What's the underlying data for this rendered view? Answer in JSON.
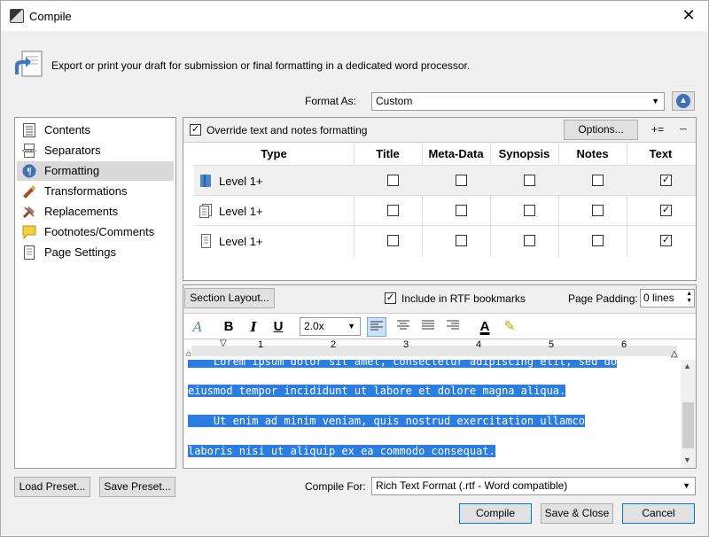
{
  "window": {
    "title": "Compile",
    "close_glyph": "✕"
  },
  "header": {
    "description": "Export or print your draft for submission or final formatting in a dedicated word processor.",
    "icon": "export-icon"
  },
  "format_as": {
    "label": "Format As:",
    "value": "Custom"
  },
  "sidebar": {
    "items": [
      {
        "label": "Contents",
        "icon": "contents-icon"
      },
      {
        "label": "Separators",
        "icon": "separators-icon"
      },
      {
        "label": "Formatting",
        "icon": "formatting-icon",
        "selected": true
      },
      {
        "label": "Transformations",
        "icon": "transformations-icon"
      },
      {
        "label": "Replacements",
        "icon": "replacements-icon"
      },
      {
        "label": "Footnotes/Comments",
        "icon": "footnotes-icon"
      },
      {
        "label": "Page Settings",
        "icon": "page-settings-icon"
      }
    ]
  },
  "formatting": {
    "override_label": "Override text and notes formatting",
    "override_checked": true,
    "options_label": "Options...",
    "add_label": "+=",
    "remove_label": "−",
    "columns": [
      "Type",
      "Title",
      "Meta-Data",
      "Synopsis",
      "Notes",
      "Text"
    ],
    "rows": [
      {
        "label": "Level 1+",
        "icon": "folder-icon",
        "checks": [
          "",
          "",
          "",
          "",
          "✓"
        ]
      },
      {
        "label": "Level 1+",
        "icon": "document-group-icon",
        "checks": [
          "",
          "",
          "",
          "",
          "✓"
        ]
      },
      {
        "label": "Level 1+",
        "icon": "document-icon",
        "checks": [
          "",
          "",
          "",
          "",
          "✓"
        ]
      }
    ]
  },
  "section": {
    "layout_button": "Section Layout...",
    "rtf_label": "Include in RTF bookmarks",
    "rtf_checked": "✓",
    "padding_label": "Page Padding:",
    "padding_value": "0 lines"
  },
  "toolbar": {
    "styles_glyph": "A",
    "bold": "B",
    "italic": "I",
    "underline": "U",
    "zoom": "2.0x",
    "text_color_glyph": "A",
    "highlight_glyph": "✎"
  },
  "ruler": {
    "numbers": [
      "1",
      "2",
      "3",
      "4",
      "5",
      "6"
    ]
  },
  "editor": {
    "lines": [
      "    Lorem ipsum dolor sit amet, consectetur adipiscing elit, sed do",
      "eiusmod tempor incididunt ut labore et dolore magna aliqua.",
      "    Ut enim ad minim veniam, quis nostrud exercitation ullamco",
      "laboris nisi ut aliquip ex ea commodo consequat."
    ]
  },
  "footer": {
    "load_preset": "Load Preset...",
    "save_preset": "Save Preset...",
    "compile_for_label": "Compile For:",
    "compile_for_value": "Rich Text Format (.rtf - Word compatible)",
    "compile": "Compile",
    "save_close": "Save & Close",
    "cancel": "Cancel"
  }
}
